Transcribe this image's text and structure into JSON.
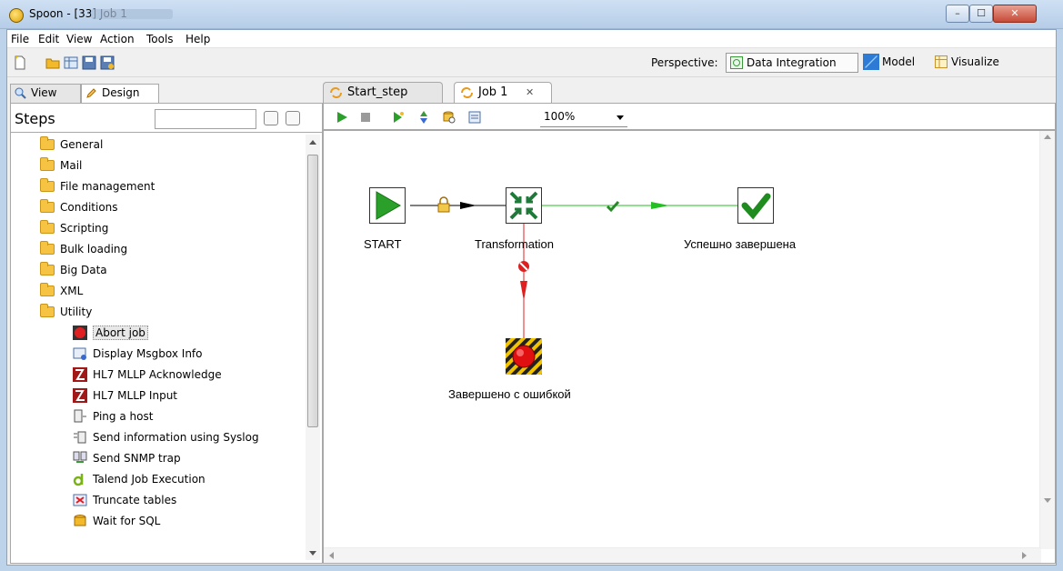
{
  "window": {
    "title": "Spoon - [33] Job 1",
    "buttons": {
      "minimize": "–",
      "maximize": "☐",
      "close": "✕"
    }
  },
  "menu": [
    "File",
    "Edit",
    "View",
    "Action",
    "Tools",
    "Help"
  ],
  "perspective": {
    "label": "Perspective:",
    "items": [
      {
        "label": "Data Integration",
        "active": true
      },
      {
        "label": "Model",
        "active": false
      },
      {
        "label": "Visualize",
        "active": false
      }
    ]
  },
  "left_tabs": {
    "view": "View",
    "design": "Design"
  },
  "steps": {
    "title": "Steps",
    "search_value": "",
    "folders": [
      "General",
      "Mail",
      "File management",
      "Conditions",
      "Scripting",
      "Bulk loading",
      "Big Data",
      "XML",
      "Utility"
    ],
    "utility_items": [
      {
        "label": "Abort job",
        "selected": true
      },
      {
        "label": "Display Msgbox Info",
        "selected": false
      },
      {
        "label": "HL7 MLLP Acknowledge",
        "selected": false
      },
      {
        "label": "HL7 MLLP Input",
        "selected": false
      },
      {
        "label": "Ping a host",
        "selected": false
      },
      {
        "label": "Send information using Syslog",
        "selected": false
      },
      {
        "label": "Send SNMP trap",
        "selected": false
      },
      {
        "label": "Talend Job Execution",
        "selected": false
      },
      {
        "label": "Truncate tables",
        "selected": false
      },
      {
        "label": "Wait for SQL",
        "selected": false
      }
    ]
  },
  "canvas_tabs": [
    {
      "label": "Start_step",
      "active": false
    },
    {
      "label": "Job 1",
      "active": true,
      "close": "✕"
    }
  ],
  "canvas_toolbar": {
    "zoom": "100%"
  },
  "job": {
    "nodes": {
      "start": "START",
      "transformation": "Transformation",
      "success": "Успешно завершена",
      "abort": "Завершено с ошибкой"
    }
  },
  "colors": {
    "hop_unconditional": "#000000",
    "hop_success": "#22c022",
    "hop_error": "#e02020",
    "start_green": "#2aa02a"
  }
}
